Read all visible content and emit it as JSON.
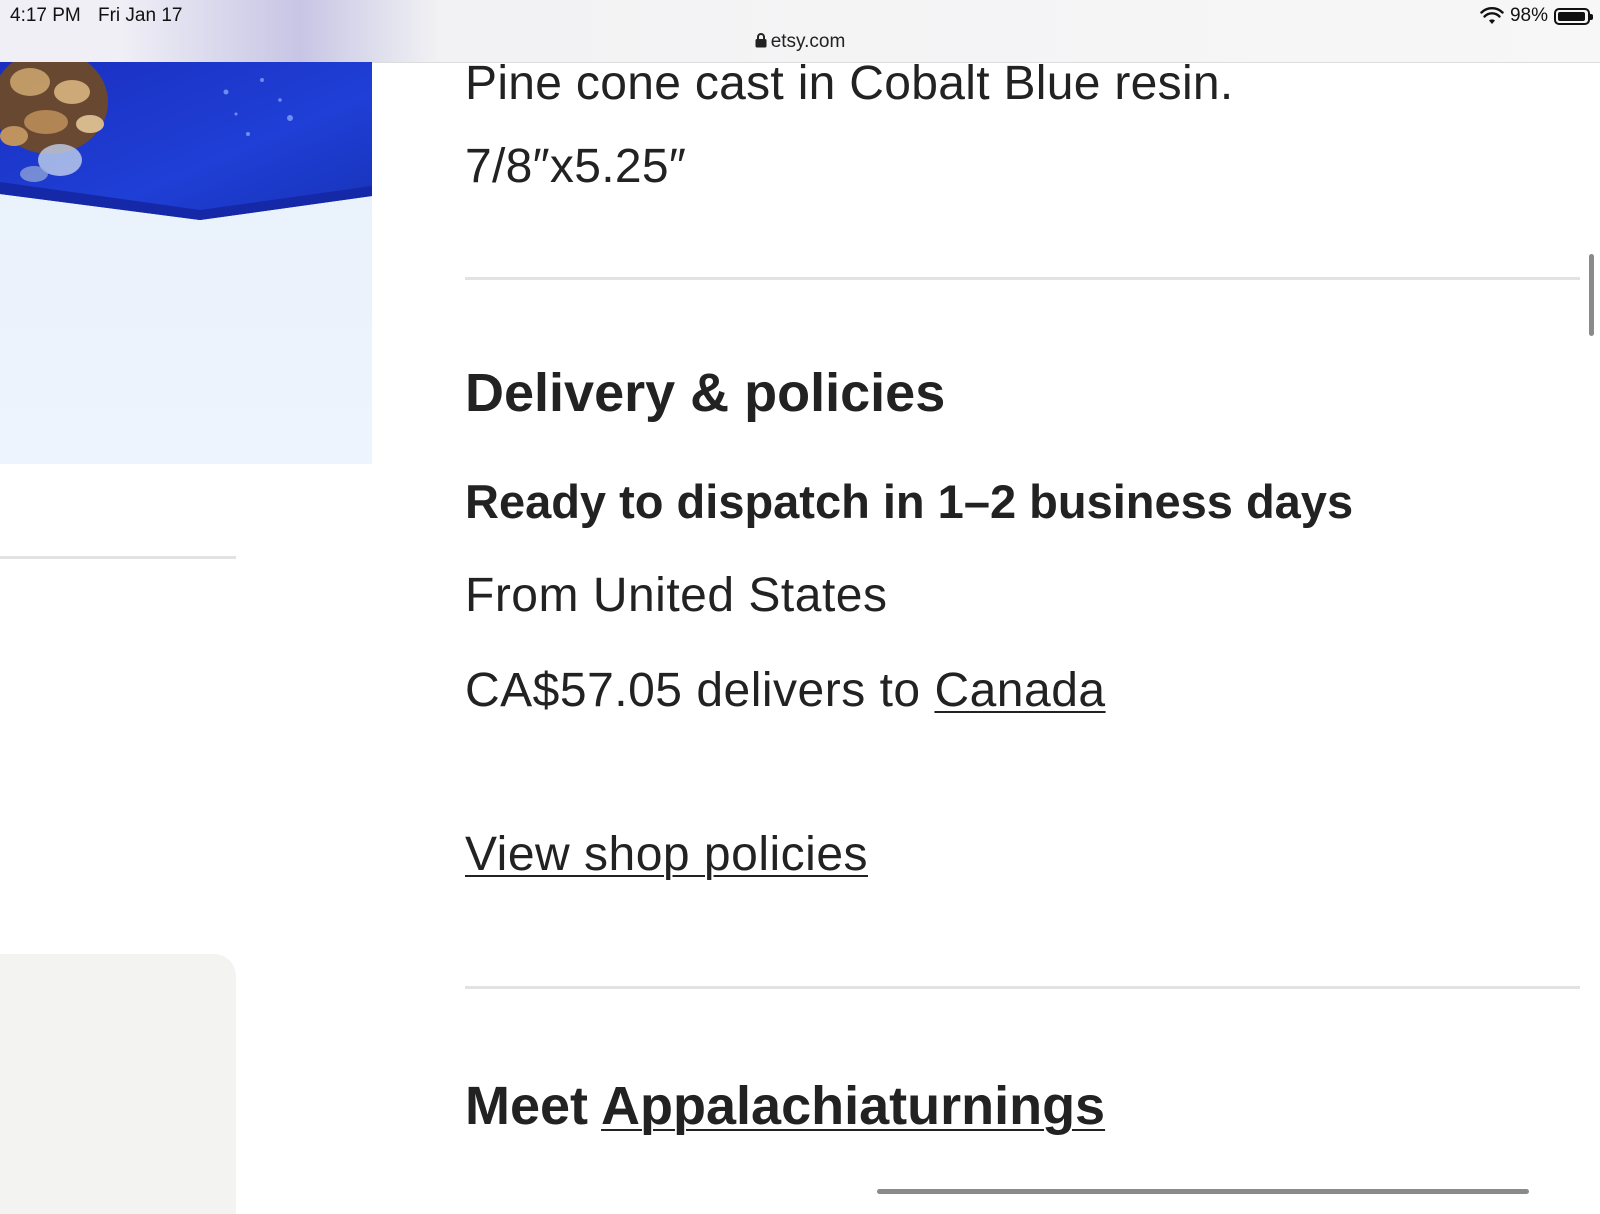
{
  "status_bar": {
    "time": "4:17 PM",
    "date": "Fri Jan 17",
    "url": "etsy.com",
    "battery_percent": "98%",
    "battery_level": 0.98
  },
  "description": {
    "line1": "Pine cone cast in Cobalt Blue resin.",
    "line2": "7/8″x5.25″"
  },
  "delivery": {
    "title": "Delivery & policies",
    "dispatch": "Ready to dispatch in 1–2 business days",
    "origin": "From United States",
    "delivery_prefix": "CA$57.05 delivers to ",
    "country_link": "Canada",
    "view_policies_link": "View shop policies"
  },
  "meet": {
    "prefix": "Meet ",
    "shop_link": "Appalachiaturnings"
  },
  "colors": {
    "resin_blue": "#1f3fd6",
    "text": "#222222",
    "divider": "#e2e2e2"
  },
  "icons": {
    "lock": "lock-icon",
    "wifi": "wifi-icon",
    "battery": "battery-icon"
  }
}
